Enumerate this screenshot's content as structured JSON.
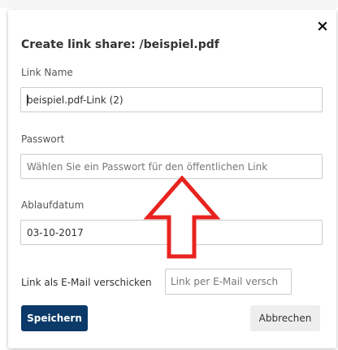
{
  "dialog": {
    "title": "Create link share: /beispiel.pdf",
    "close_symbol": "×"
  },
  "form": {
    "link_name": {
      "label": "Link Name",
      "value": "beispiel.pdf-Link (2)"
    },
    "password": {
      "label": "Passwort",
      "placeholder": "Wählen Sie ein Passwort für den öffentlichen Link"
    },
    "expiry": {
      "label": "Ablaufdatum",
      "value": "03-10-2017"
    },
    "email": {
      "label": "Link als E-Mail verschicken",
      "placeholder": "Link per E-Mail versch"
    }
  },
  "actions": {
    "save_label": "Speichern",
    "cancel_label": "Abbrechen"
  },
  "annotation": {
    "arrow_icon": "red-up-arrow-icon",
    "color": "#e8231f"
  },
  "colors": {
    "primary_button": "#0b3a68"
  }
}
